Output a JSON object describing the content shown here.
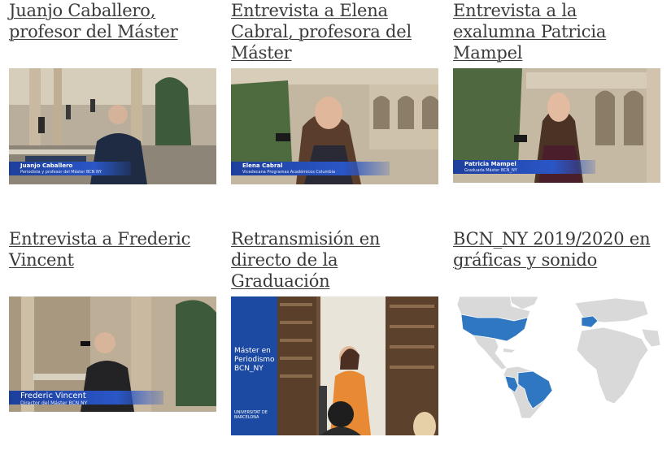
{
  "cards": [
    {
      "title": "Juanjo Caballero, profesor del Máster",
      "lower_third": {
        "name": "Juanjo Caballero",
        "role": "Periodista y profesor del Máster BCN NY"
      }
    },
    {
      "title": "Entrevista a Elena Cabral, profesora del Máster",
      "lower_third": {
        "name": "Elena Cabral",
        "role": "Vicedecana Programas Académicos Columbia"
      }
    },
    {
      "title": "Entrevista a la exalumna Patricia Mampel",
      "lower_third": {
        "name": "Patricia Mampel",
        "role": "Graduada Máster BCN_NY"
      }
    },
    {
      "title": "Entrevista a Frederic Vincent",
      "lower_third": {
        "name": "Frederic Vincent",
        "role": "Director del Máster BCN NY"
      }
    },
    {
      "title": "Retransmisión en directo de la Graduación",
      "banner": {
        "line1": "Máster en",
        "line2": "Periodismo",
        "line3": "BCN_NY",
        "footer": "UNIVERSITAT DE BARCELONA"
      }
    },
    {
      "title": "BCN_NY 2019/2020 en gráficas y sonido"
    }
  ],
  "colors": {
    "highlight": "#2f77c0",
    "land": "#d9d9d9",
    "banner": "#1c4aa3"
  }
}
